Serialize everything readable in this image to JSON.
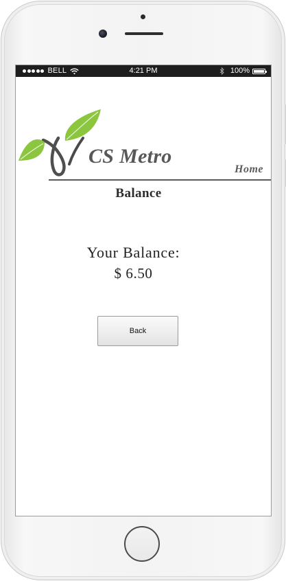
{
  "status_bar": {
    "carrier": "BELL",
    "time": "4:21 PM",
    "battery": "100%"
  },
  "header": {
    "brand": "CS Metro",
    "home_link": "Home"
  },
  "page": {
    "title": "Balance",
    "balance_label": "Your Balance:",
    "balance_value": "$ 6.50",
    "back_button": "Back"
  },
  "colors": {
    "leaf_green": "#8cc63f",
    "brand_gray": "#585858",
    "status_bar_bg": "#1e1e1e"
  },
  "icons": {
    "logo": "sprout-leaf-logo",
    "wifi": "wifi-icon",
    "bluetooth": "bluetooth-icon",
    "battery": "battery-icon"
  }
}
